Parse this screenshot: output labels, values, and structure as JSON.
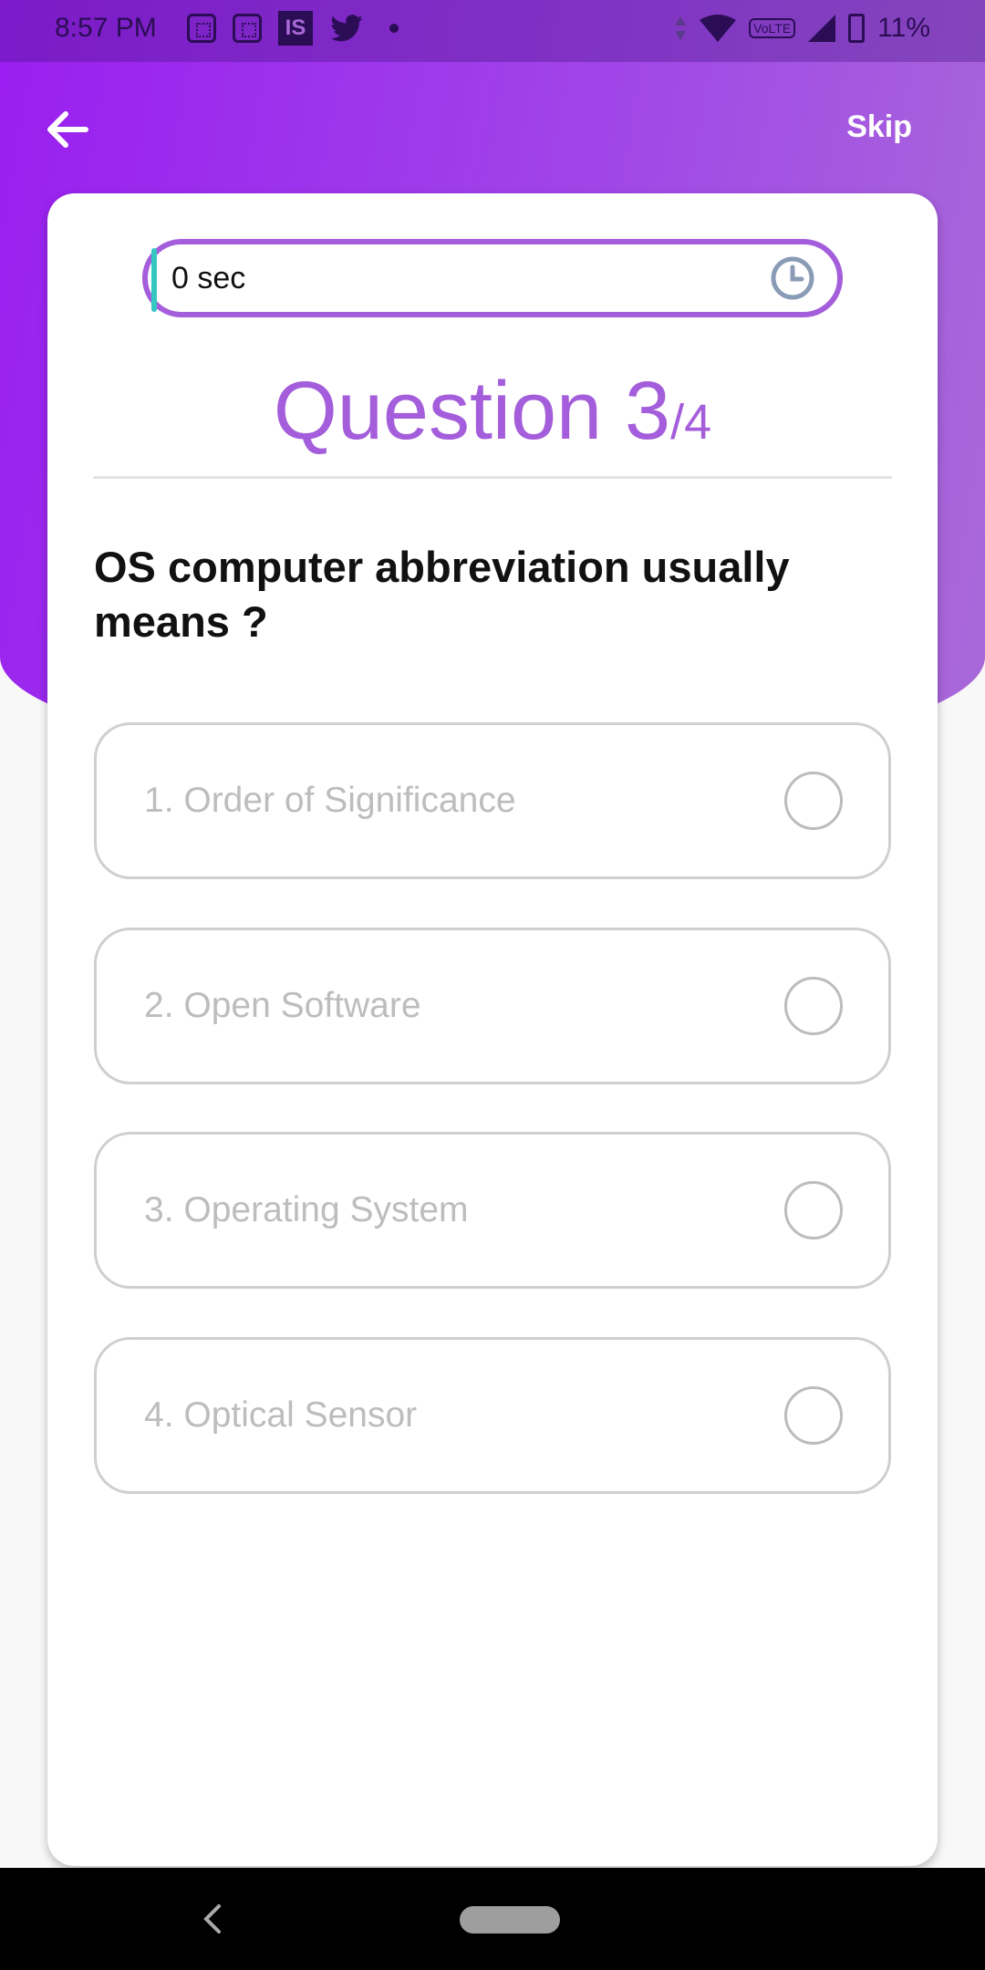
{
  "status_bar": {
    "time": "8:57 PM",
    "battery": "11%",
    "left_icons": [
      "grid-app-icon",
      "grid-app-icon",
      "is-app-icon",
      "twitter-bird-icon",
      "notification-dot-icon"
    ],
    "right_icons": [
      "data-arrows-icon",
      "wifi-icon",
      "volte-icon",
      "signal-icon",
      "battery-icon"
    ],
    "volte_label": "VoLTE"
  },
  "header": {
    "skip_label": "Skip",
    "back_icon": "arrow-left-icon"
  },
  "timer": {
    "text": "0 sec",
    "icon": "clock-icon",
    "progress": 0
  },
  "question": {
    "label": "Question 3",
    "total": "/4",
    "text": "OS computer abbreviation usually means ?"
  },
  "options": [
    {
      "label": "1. Order of Significance"
    },
    {
      "label": "2. Open Software"
    },
    {
      "label": "3. Operating System"
    },
    {
      "label": "4. Optical Sensor"
    }
  ],
  "colors": {
    "accent": "#a45ddb",
    "header_start": "#9a1ef0",
    "header_end": "#a96ad8",
    "timer_fill": "#35c7c2"
  }
}
